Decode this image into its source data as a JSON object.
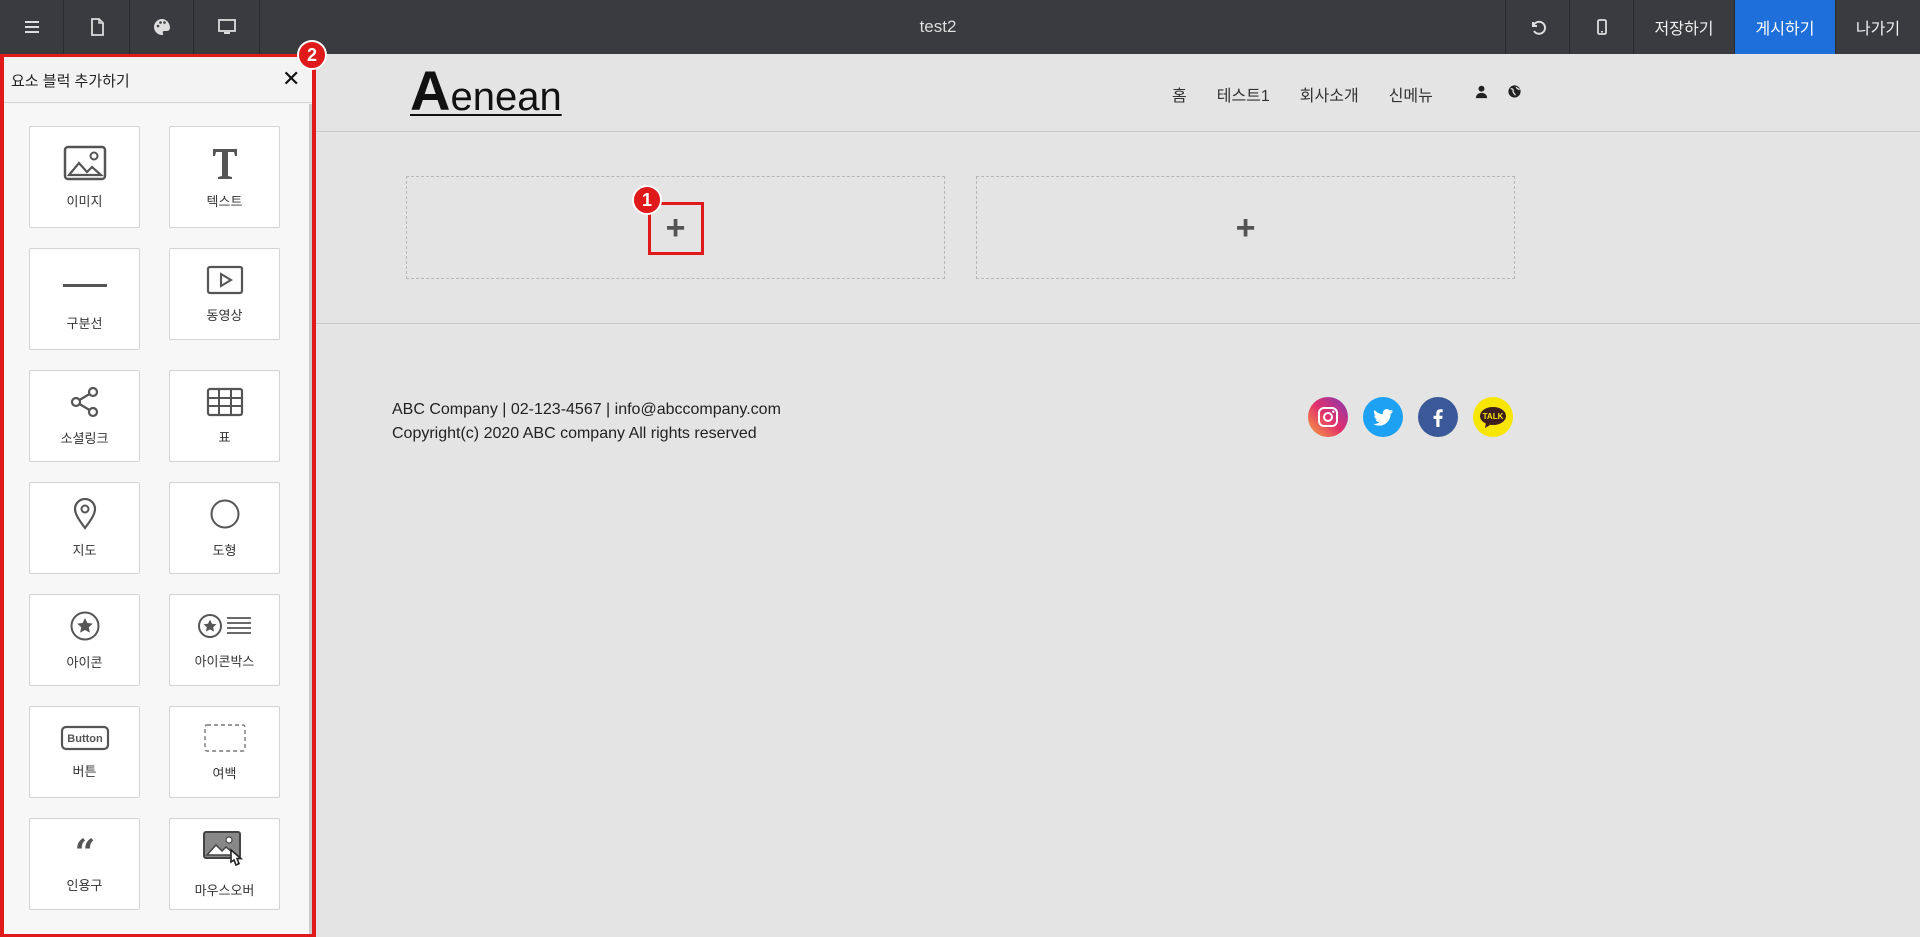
{
  "topbar": {
    "title": "test2",
    "icons": [
      "menu-icon",
      "page-icon",
      "palette-icon",
      "desktop-icon"
    ],
    "undo_icon": "undo-icon",
    "mobile_icon": "mobile-icon",
    "save_label": "저장하기",
    "publish_label": "게시하기",
    "exit_label": "나가기",
    "publish_color": "#1e6fd9"
  },
  "site": {
    "logo_big": "A",
    "logo_rest": "enean",
    "nav": [
      "홈",
      "테스트1",
      "회사소개",
      "신메뉴"
    ],
    "nav_icons": [
      "user-icon",
      "globe-icon"
    ],
    "slots": [
      "+",
      "+"
    ],
    "footer_line1": "ABC Company | 02-123-4567 | info@abccompany.com",
    "footer_line2": "Copyright(c) 2020 ABC company All rights reserved",
    "social": [
      {
        "name": "instagram-icon",
        "color": "#c13584"
      },
      {
        "name": "twitter-icon",
        "color": "#1da1f2"
      },
      {
        "name": "facebook-icon",
        "color": "#3b5998"
      },
      {
        "name": "kakaotalk-icon",
        "color": "#f7e600",
        "text": "TALK"
      }
    ]
  },
  "markers": {
    "one": "1",
    "two": "2",
    "color": "#e01a1a"
  },
  "panel": {
    "title": "요소 블럭 추가하기",
    "close": "✕",
    "tiles": [
      {
        "label": "이미지",
        "icon": "image-icon"
      },
      {
        "label": "텍스트",
        "icon": "text-icon"
      },
      {
        "label": "구분선",
        "icon": "divider-icon"
      },
      {
        "label": "동영상",
        "icon": "video-icon"
      },
      {
        "label": "소셜링크",
        "icon": "share-icon"
      },
      {
        "label": "표",
        "icon": "table-icon"
      },
      {
        "label": "지도",
        "icon": "map-pin-icon"
      },
      {
        "label": "도형",
        "icon": "circle-icon"
      },
      {
        "label": "아이콘",
        "icon": "star-icon"
      },
      {
        "label": "아이콘박스",
        "icon": "icon-box-icon"
      },
      {
        "label": "버튼",
        "icon": "button-icon",
        "icon_text": "Button"
      },
      {
        "label": "여백",
        "icon": "spacer-icon"
      },
      {
        "label": "인용구",
        "icon": "quote-icon",
        "icon_text": "“"
      },
      {
        "label": "마우스오버",
        "icon": "mouseover-icon"
      }
    ]
  }
}
